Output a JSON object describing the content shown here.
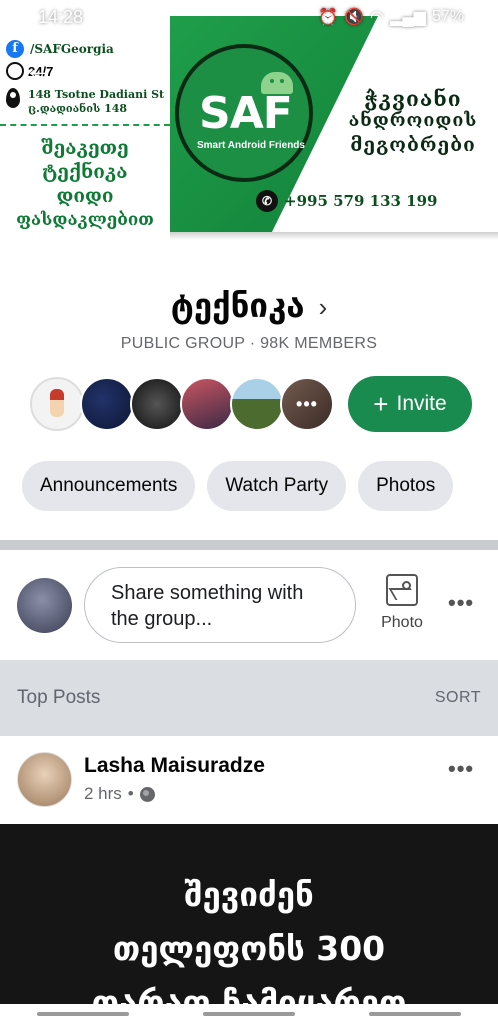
{
  "status_bar": {
    "time": "14:28",
    "battery": "57%"
  },
  "cover": {
    "facebook_handle": "/SAFGeorgia",
    "hours": "24/7",
    "address_line1": "148 Tsotne Dadiani St",
    "address_line2": "ც.დადიანის 148",
    "left_slogan": [
      "შეაკეთე",
      "ტექნიკა",
      "დიდი",
      "ფასდაკლებით"
    ],
    "logo_text": "SAF",
    "logo_subtitle": "Smart Android Friends",
    "right_slogan": [
      "ჭკვიანი",
      "ანდროიდის",
      "მეგობრები"
    ],
    "phone": "+995 579 133 199"
  },
  "group": {
    "title": "ტექნიკა",
    "meta": "PUBLIC GROUP · 98K MEMBERS",
    "invite_label": "Invite",
    "more_members": "•••"
  },
  "tabs": [
    "Announcements",
    "Watch Party",
    "Photos"
  ],
  "composer": {
    "placeholder": "Share something with the group...",
    "photo_label": "Photo"
  },
  "top_posts": {
    "title": "Top Posts",
    "sort_label": "SORT"
  },
  "post": {
    "author": "Lasha Maisuradze",
    "time": "2 hrs",
    "image_text": [
      "შევიძენ",
      "თელეფონს 300",
      "თარაფ ჩამიყარეთ"
    ]
  },
  "colors": {
    "accent": "#1a8b4e",
    "cover_green": "#1f9e4a",
    "link_blue": "#1877f2"
  }
}
